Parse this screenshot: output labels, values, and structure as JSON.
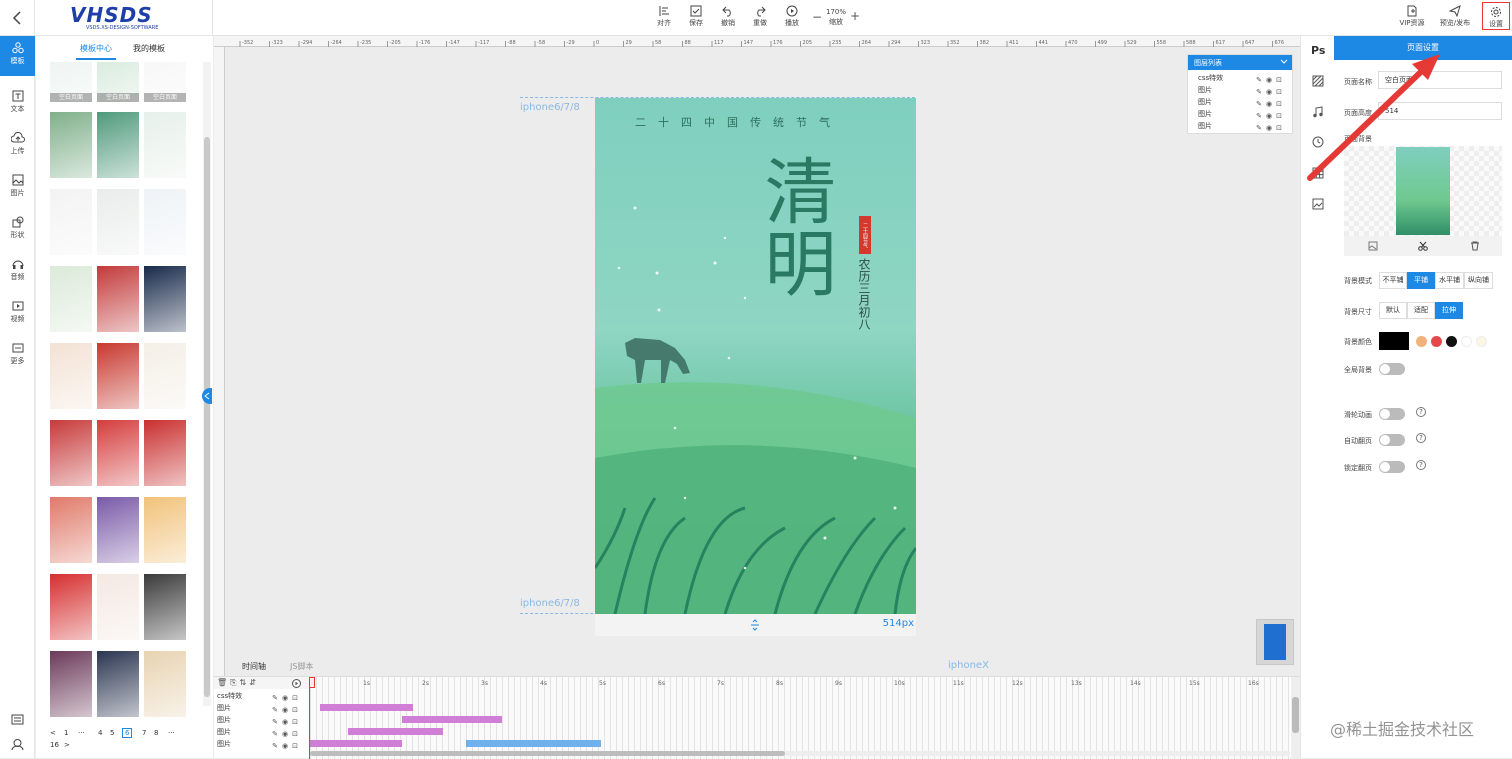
{
  "topbar": {
    "logo_text": "VHSDS",
    "logo_sub": "VSDS.XS-DESIGN-SOFTWARE",
    "tools": [
      {
        "label": "对齐",
        "icon": "align-icon"
      },
      {
        "label": "保存",
        "icon": "save-icon"
      },
      {
        "label": "撤销",
        "icon": "undo-icon"
      },
      {
        "label": "重做",
        "icon": "redo-icon"
      },
      {
        "label": "播放",
        "icon": "play-icon"
      }
    ],
    "zoom_value": "170%",
    "zoom_label": "缩放",
    "zoom_minus": "−",
    "zoom_plus": "+",
    "right_tools": [
      {
        "label": "VIP资源",
        "icon": "vip-icon"
      },
      {
        "label": "预览/发布",
        "icon": "send-icon"
      },
      {
        "label": "设置",
        "icon": "gear-icon"
      }
    ]
  },
  "leftnav": {
    "items": [
      "模板",
      "文本",
      "上传",
      "图片",
      "形状",
      "音频",
      "视频",
      "更多"
    ]
  },
  "panel": {
    "tabs": [
      "模板中心",
      "我的模板"
    ],
    "thumb_caption": "空白页面",
    "pagination": [
      "<",
      "1",
      "···",
      "4",
      "5",
      "6",
      "7",
      "8",
      "···",
      "16",
      ">"
    ],
    "current_page": "6"
  },
  "canvas": {
    "device_label_top": "iphone6/7/8",
    "device_label_bottom": "iphone6/7/8",
    "iphonex_label": "iphoneX",
    "height_label": "514px",
    "poster_top_text": "二十四中国传统节气",
    "poster_title": "清明",
    "poster_side_text": "农历三月初八",
    "poster_seal": "二十四节气",
    "ruler_ticks": [
      "-352",
      "-323",
      "-294",
      "-264",
      "-235",
      "-205",
      "-176",
      "-147",
      "-117",
      "-88",
      "-58",
      "-29",
      "0",
      "29",
      "58",
      "88",
      "117",
      "147",
      "176",
      "205",
      "235",
      "264",
      "294",
      "323",
      "352",
      "382",
      "411",
      "441",
      "470",
      "499",
      "529",
      "558",
      "588",
      "617",
      "647",
      "676"
    ]
  },
  "layerlist": {
    "title": "图层列表",
    "rows": [
      "css特效",
      "图片",
      "图片",
      "图片",
      "图片"
    ]
  },
  "rightstrip": {
    "ps_label": "Ps"
  },
  "rightpanel": {
    "title": "页面设置",
    "name_label": "页面名称",
    "name_value": "空白页面",
    "height_label": "页面高度",
    "height_value": "514",
    "bg_label": "页面背景",
    "bg_mode_label": "背景模式",
    "bg_modes": [
      "不平铺",
      "平铺",
      "水平铺",
      "纵向铺"
    ],
    "bg_mode_selected": "平铺",
    "bg_size_label": "背景尺寸",
    "bg_sizes": [
      "默认",
      "适配",
      "拉伸"
    ],
    "bg_size_selected": "拉伸",
    "bg_color_label": "背景颜色",
    "colors": [
      "#000000",
      "#f2b27c",
      "#e5474b",
      "#111111",
      "#ffffff",
      "#fdf6e3"
    ],
    "global_bg_label": "全局背景",
    "toggles": [
      {
        "label": "滑轮动画"
      },
      {
        "label": "自动翻页"
      },
      {
        "label": "锁定翻页"
      }
    ]
  },
  "timeline": {
    "tabs": [
      "时间轴",
      "JS脚本"
    ],
    "rows": [
      "css特效",
      "图片",
      "图片",
      "图片",
      "图片"
    ],
    "ticks": [
      "1s",
      "2s",
      "3s",
      "4s",
      "5s",
      "6s",
      "7s",
      "8s",
      "9s",
      "10s",
      "11s",
      "12s",
      "13s",
      "14s",
      "15s",
      "16s"
    ]
  },
  "watermark": "@稀土掘金技术社区"
}
